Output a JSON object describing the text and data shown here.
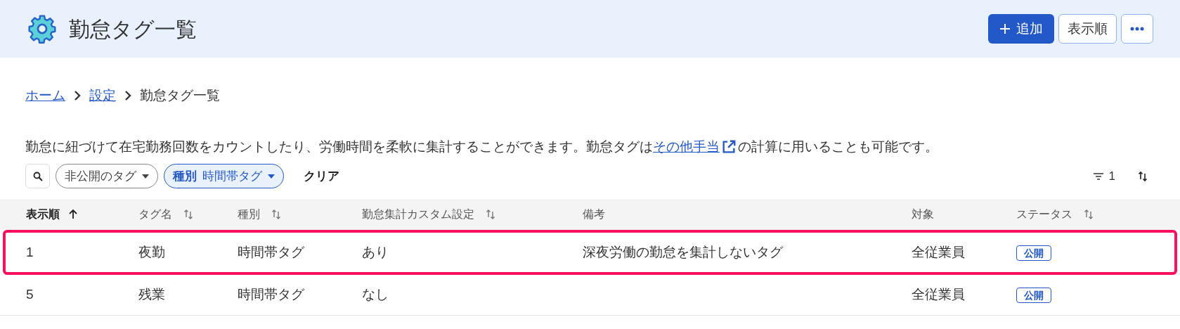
{
  "header": {
    "title": "勤怠タグ一覧",
    "buttons": [
      {
        "kind": "add",
        "label": "追加"
      },
      {
        "kind": "text",
        "label": "表示順"
      },
      {
        "kind": "more"
      }
    ]
  },
  "breadcrumb": [
    {
      "label": "ホーム",
      "link": true
    },
    {
      "label": "設定",
      "link": true
    },
    {
      "label": "勤怠タグ一覧",
      "link": false
    }
  ],
  "description": {
    "before": "勤怠に紐づけて在宅勤務回数をカウントしたり、労働時間を柔軟に集計することができます。勤怠タグは",
    "link": "その他手当",
    "after": "の計算に用いることも可能です。"
  },
  "filters": [
    {
      "label": "非公開のタグ",
      "selected": false
    },
    {
      "prefix": "種別",
      "label": "時間帯タグ",
      "selected": true
    }
  ],
  "clear_label": "クリア",
  "filter_count": "1",
  "table": {
    "columns": [
      {
        "label": "表示順",
        "kind": "sorted"
      },
      {
        "label": "タグ名",
        "kind": "sortable"
      },
      {
        "label": "種別",
        "kind": "sortable"
      },
      {
        "label": "勤怠集計カスタム設定",
        "kind": "sortable"
      },
      {
        "label": "備考",
        "kind": "plain"
      },
      {
        "label": "対象",
        "kind": "plain"
      },
      {
        "label": "ステータス",
        "kind": "sortable"
      }
    ],
    "rows": [
      {
        "highlighted": true,
        "cells": [
          "1",
          "夜勤",
          "時間帯タグ",
          "あり",
          "深夜労働の勤怠を集計しないタグ",
          "全従業員"
        ],
        "status": "公開"
      },
      {
        "highlighted": false,
        "cells": [
          "5",
          "残業",
          "時間帯タグ",
          "なし",
          "",
          "全従業員"
        ],
        "status": "公開"
      }
    ]
  }
}
